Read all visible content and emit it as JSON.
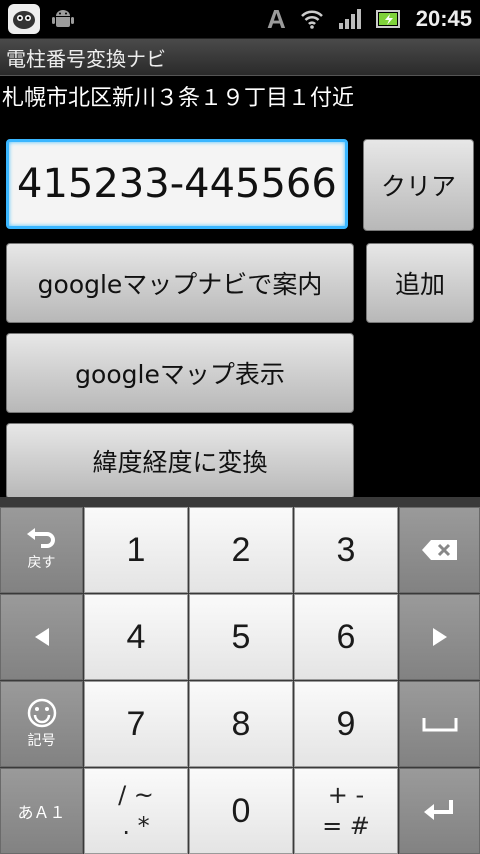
{
  "status_bar": {
    "time": "20:45",
    "icons": [
      "app-notification-icon",
      "android-icon",
      "font-icon",
      "wifi-icon",
      "signal-icon",
      "battery-icon"
    ],
    "font_glyph": "A"
  },
  "title_bar": {
    "title": "電柱番号変換ナビ"
  },
  "address": "札幌市北区新川３条１９丁目１付近",
  "input": {
    "value": "415233-445566"
  },
  "buttons": {
    "clear": "クリア",
    "navi": "googleマップナビで案内",
    "add": "追加",
    "show_map": "googleマップ表示",
    "convert": "緯度経度に変換"
  },
  "keyboard": {
    "back_label": "戻す",
    "symbols_label": "記号",
    "mode_label": "あＡ１",
    "keys": [
      "1",
      "2",
      "3",
      "4",
      "5",
      "6",
      "7",
      "8",
      "9",
      "0"
    ],
    "sym_key_1_top": "/  ~",
    "sym_key_1_bottom": ".  *",
    "sym_key_2_top": "+  -",
    "sym_key_2_bottom": "=  #"
  },
  "colors": {
    "input_focus": "#3ab6ff",
    "background": "#000000"
  }
}
